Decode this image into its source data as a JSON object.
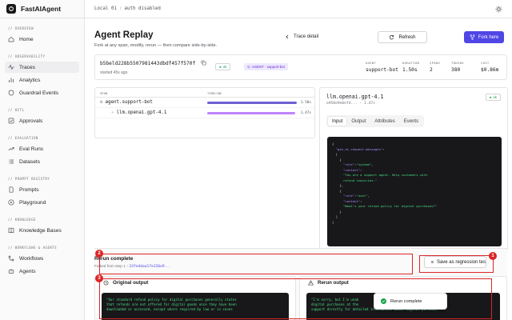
{
  "app": {
    "name": "FastAIAgent"
  },
  "topbar": {
    "env": "Local 01",
    "auth": "auth disabled"
  },
  "sidebar": {
    "sections": [
      {
        "label": "// OVERVIEW",
        "items": [
          {
            "label": "Home",
            "icon": "home-icon"
          }
        ]
      },
      {
        "label": "// OBSERVABILITY",
        "items": [
          {
            "label": "Traces",
            "icon": "activity-icon",
            "active": true
          },
          {
            "label": "Analytics",
            "icon": "bar-chart-icon"
          },
          {
            "label": "Guardrail Events",
            "icon": "shield-icon"
          }
        ]
      },
      {
        "label": "// HITL",
        "items": [
          {
            "label": "Approvals",
            "icon": "check-square-icon"
          }
        ]
      },
      {
        "label": "// EVALUATION",
        "items": [
          {
            "label": "Eval Runs",
            "icon": "trending-icon"
          },
          {
            "label": "Datasets",
            "icon": "list-icon"
          }
        ]
      },
      {
        "label": "// PROMPT REGISTRY",
        "items": [
          {
            "label": "Prompts",
            "icon": "file-icon"
          },
          {
            "label": "Playground",
            "icon": "play-icon"
          }
        ]
      },
      {
        "label": "// KNOWLEDGE",
        "items": [
          {
            "label": "Knowledge Bases",
            "icon": "book-icon"
          }
        ]
      },
      {
        "label": "// WORKFLOWS & AGENTS",
        "items": [
          {
            "label": "Workflows",
            "icon": "workflow-icon"
          },
          {
            "label": "Agents",
            "icon": "bot-icon"
          }
        ]
      }
    ]
  },
  "page": {
    "title": "Agent Replay",
    "subtitle": "Fork at any span, modify, rerun — then compare side-by-side.",
    "back_label": "Trace detail",
    "refresh_label": "Refresh",
    "fork_label": "Fork here"
  },
  "summary": {
    "trace_id": "b5beld228b5507981443dbdf457f570f",
    "age": "started 45s ago",
    "status": "ok",
    "agent_badge": "AGENT · support-bot",
    "stats": [
      {
        "label": "AGENT",
        "value": "support-bot"
      },
      {
        "label": "DURATION",
        "value": "1.50s"
      },
      {
        "label": "SPANS",
        "value": "2"
      },
      {
        "label": "TOKENS",
        "value": "380"
      },
      {
        "label": "COST",
        "value": "$0.86m"
      }
    ]
  },
  "timeline": {
    "headers": [
      "SPAN",
      "TIMELINE"
    ],
    "rows": [
      {
        "name": "agent.support-bot",
        "duration": "1.50s",
        "fraction": 1.0,
        "color": "#6d5fd3"
      },
      {
        "name": "llm.openai.gpt-4.1",
        "duration": "1.47s",
        "fraction": 0.98,
        "color": "#c084fc"
      }
    ]
  },
  "span": {
    "title": "llm.openai.gpt-4.1",
    "sub": "e958e9e6ef4... · 1.47s",
    "status": "ok",
    "tabs": [
      "Input",
      "Output",
      "Attributes",
      "Events"
    ],
    "active_tab": "Input",
    "code_lines": [
      "{",
      "  \"gen_ai.request.messages\":",
      "  [",
      "    {",
      "      \"role\":\"system\",",
      "      \"content\":",
      "      \"You are a support agent. Help customers with",
      "      refund inquiries.\"",
      "    },",
      "    {",
      "      \"role\":\"user\",",
      "      \"content\":",
      "      \"What's your refund policy for digital purchases?\"",
      "    }",
      "  ]",
      "}"
    ]
  },
  "rerun": {
    "title": "Rerun complete",
    "forked_from": "Forked from step 1",
    "fork_id": "33fe4daa17e226e9...",
    "save_label": "Save as regression tes",
    "original_label": "Original output",
    "rerun_label": "Rerun output",
    "original_text": "\"Our standard refund policy for digital purchases generally states\nthat refunds are not offered for digital goods once they have been\ndownloaded or accessed, except where required by law or in cases",
    "rerun_text": "\"I'm sorry, but I'm unab\ndigital purchases at the\nsupport directly for detailed information about digital purchase"
  },
  "toast": {
    "message": "Rerun complete"
  },
  "markers": [
    "1",
    "2",
    "3"
  ],
  "colors": {
    "accent": "#4f46e5",
    "ok": "#16a34a",
    "marker": "#dc2626"
  }
}
